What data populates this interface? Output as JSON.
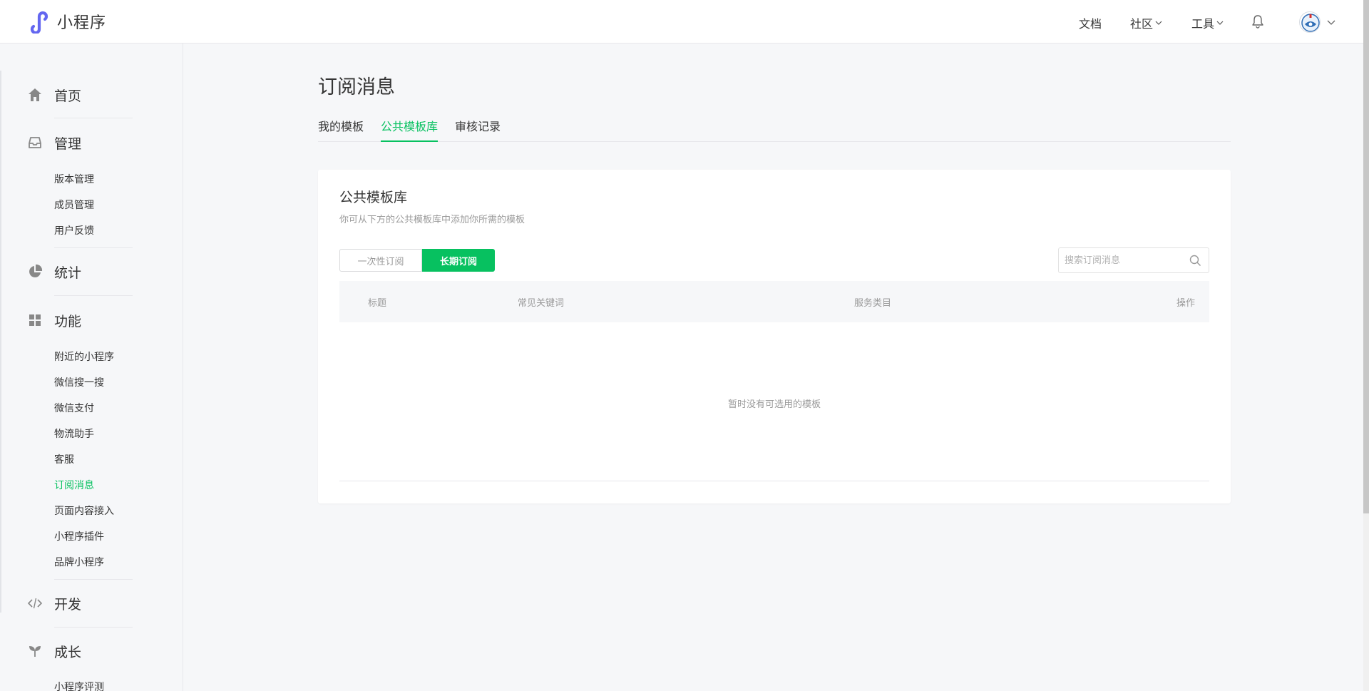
{
  "brand": {
    "name": "小程序"
  },
  "topnav": {
    "docs": "文档",
    "community": "社区",
    "tools": "工具"
  },
  "sidebar": {
    "home": "首页",
    "manage": {
      "label": "管理",
      "items": [
        "版本管理",
        "成员管理",
        "用户反馈"
      ]
    },
    "stats": "统计",
    "features": {
      "label": "功能",
      "items": [
        "附近的小程序",
        "微信搜一搜",
        "微信支付",
        "物流助手",
        "客服",
        "订阅消息",
        "页面内容接入",
        "小程序插件",
        "品牌小程序"
      ],
      "active_index": 5
    },
    "develop": "开发",
    "growth": {
      "label": "成长",
      "items": [
        "小程序评测"
      ]
    }
  },
  "main": {
    "title": "订阅消息",
    "tabs": [
      {
        "label": "我的模板",
        "active": false
      },
      {
        "label": "公共模板库",
        "active": true
      },
      {
        "label": "审核记录",
        "active": false
      }
    ]
  },
  "card": {
    "title": "公共模板库",
    "desc": "你可从下方的公共模板库中添加你所需的模板",
    "segment": {
      "once": "一次性订阅",
      "long": "长期订阅",
      "selected": "长期订阅"
    },
    "search": {
      "placeholder": "搜索订阅消息",
      "value": ""
    },
    "columns": [
      "标题",
      "常见关键词",
      "服务类目",
      "操作"
    ],
    "empty_text": "暂时没有可选用的模板"
  },
  "colors": {
    "accent": "#07c160",
    "text": "#353535",
    "muted": "#9a9a9a",
    "page_bg": "#f6f7f9"
  }
}
